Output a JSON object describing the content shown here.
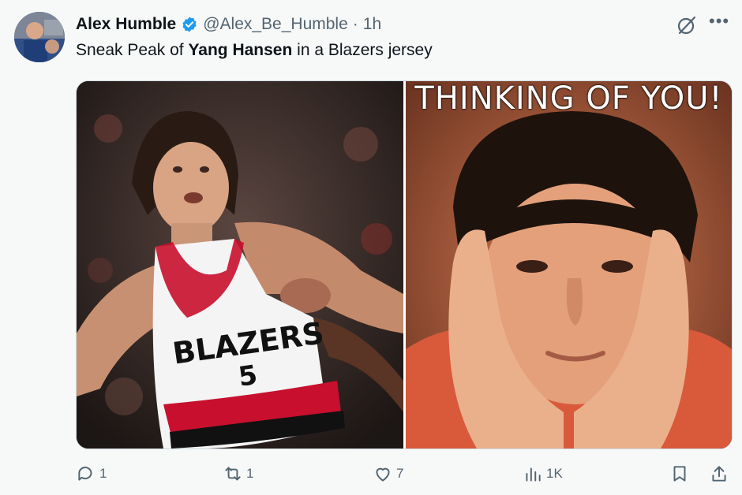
{
  "tweet": {
    "author_name": "Alex Humble",
    "handle": "@Alex_Be_Humble",
    "separator": "·",
    "time": "1h",
    "text_before": "Sneak Peak of ",
    "text_bold": "Yang Hansen",
    "text_after": " in a Blazers jersey"
  },
  "media": {
    "photo1": {
      "jersey_text": "BLAZERS",
      "jersey_number": "5"
    },
    "photo2": {
      "caption": "THINKING OF YOU!"
    }
  },
  "actions": {
    "reply_count": "1",
    "retweet_count": "1",
    "like_count": "7",
    "views_count": "1K"
  },
  "colors": {
    "verified": "#1d9bf0",
    "muted": "#536471",
    "blazers_red": "#c8102e"
  },
  "icons": [
    "verified-badge-icon",
    "grok-icon",
    "more-icon",
    "reply-icon",
    "retweet-icon",
    "like-icon",
    "views-icon",
    "bookmark-icon",
    "share-icon"
  ]
}
